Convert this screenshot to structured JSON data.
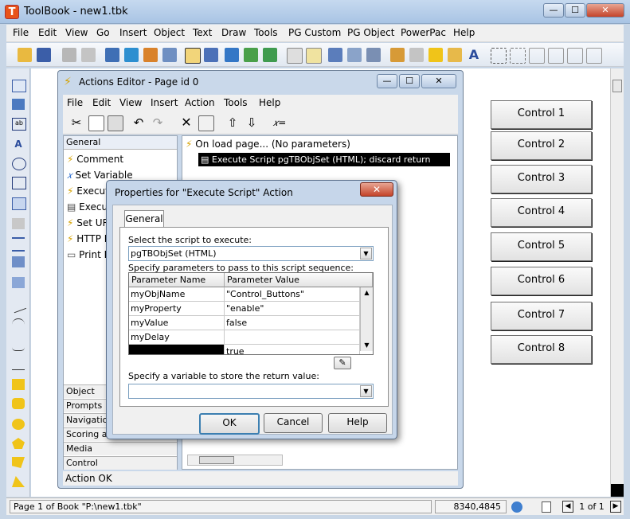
{
  "window": {
    "title": "ToolBook - new1.tbk",
    "app_icon_letter": "T",
    "min": "—",
    "max": "☐",
    "close": "✕"
  },
  "menu": [
    "File",
    "Edit",
    "View",
    "Go",
    "Insert",
    "Object",
    "Text",
    "Draw",
    "Tools",
    "PG Custom",
    "PG Object",
    "PowerPac",
    "Help"
  ],
  "controls": [
    "Control 1",
    "Control 2",
    "Control 3",
    "Control 4",
    "Control 5",
    "Control 6",
    "Control 7",
    "Control 8"
  ],
  "status": {
    "page": "Page 1 of Book \"P:\\new1.tbk\"",
    "coords": "8340,4845",
    "page_of": "1 of 1"
  },
  "actions_editor": {
    "title": "Actions Editor - Page id 0",
    "menu": [
      "File",
      "Edit",
      "View",
      "Insert",
      "Action",
      "Tools",
      "Help"
    ],
    "left_header": "General",
    "left_items": [
      "Comment",
      "Set Variable",
      "Execute",
      "Execute",
      "Set UR",
      "HTTP P",
      "Print Pa"
    ],
    "categories": [
      "Object",
      "Prompts",
      "Navigation",
      "Scoring and",
      "Media",
      "Control"
    ],
    "tree": {
      "event": "On load page... (No parameters)",
      "action": "Execute Script pgTBObjSet (HTML); discard return value"
    },
    "status": "Action OK"
  },
  "dialog": {
    "title": "Properties for \"Execute Script\" Action",
    "close": "✕",
    "tab": "General",
    "script_label": "Select the script to execute:",
    "script_value": "pgTBObjSet (HTML)",
    "params_label": "Specify parameters to pass to this script sequence:",
    "columns": [
      "Parameter Name",
      "Parameter Value"
    ],
    "rows": [
      {
        "name": "myObjName",
        "value": "\"Control_Buttons\""
      },
      {
        "name": "myProperty",
        "value": "\"enable\""
      },
      {
        "name": "myValue",
        "value": "false"
      },
      {
        "name": "myDelay",
        "value": ""
      },
      {
        "name": "",
        "value": "true"
      }
    ],
    "return_label": "Specify a variable to store the return value:",
    "return_value": "",
    "buttons": {
      "ok": "OK",
      "cancel": "Cancel",
      "help": "Help"
    }
  },
  "colors": {
    "selection": "#000000",
    "accent": "#c4442a"
  }
}
